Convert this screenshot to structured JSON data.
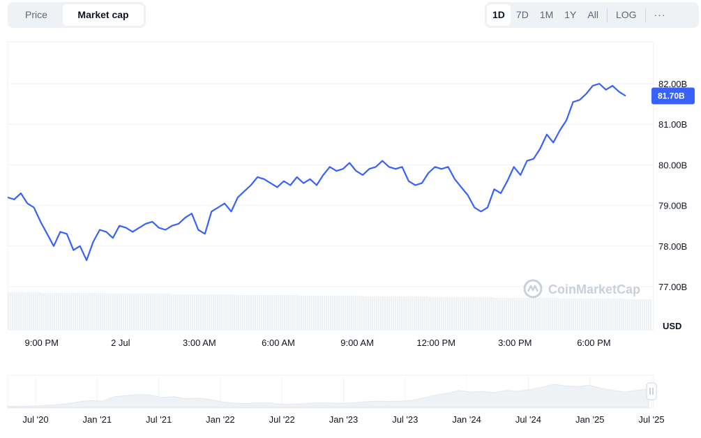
{
  "toggle": {
    "price_label": "Price",
    "market_cap_label": "Market cap",
    "selected": "Market cap"
  },
  "range_buttons": [
    "1D",
    "7D",
    "1M",
    "1Y",
    "All"
  ],
  "range_selected": "1D",
  "log_label": "LOG",
  "more_label": "···",
  "currency_label": "USD",
  "watermark": "CoinMarketCap",
  "colors": {
    "line": "#3861fb",
    "tag_bg": "#3861fb",
    "grid": "#eff2f5",
    "volume": "#eff2f5",
    "overview_fill": "#eff2f5"
  },
  "chart_data": {
    "type": "line",
    "main": {
      "x_tick_labels": [
        "9:00 PM",
        "2 Jul",
        "3:00 AM",
        "6:00 AM",
        "9:00 AM",
        "12:00 PM",
        "3:00 PM",
        "6:00 PM"
      ],
      "y_tick_labels": [
        "77.00B",
        "78.00B",
        "79.00B",
        "80.00B",
        "81.00B",
        "82.00B"
      ],
      "ylim": [
        77.0,
        82.0
      ],
      "y_unit": "USD",
      "current_value": 81.7,
      "current_label": "81.70B",
      "series": [
        {
          "x_hours": [
            0,
            0.25,
            0.5,
            0.75,
            1.0,
            1.25,
            1.5,
            1.75,
            2.0,
            2.25,
            2.5,
            2.75,
            3.0,
            3.25,
            3.5,
            3.75,
            4.0,
            4.25,
            4.5,
            4.75,
            5.0,
            5.25,
            5.5,
            5.75,
            6.0,
            6.25,
            6.5,
            6.75,
            7.0,
            7.25,
            7.5,
            7.75,
            8.0,
            8.25,
            8.5,
            8.75,
            9.0,
            9.25,
            9.5,
            9.75,
            10.0,
            10.25,
            10.5,
            10.75,
            11.0,
            11.25,
            11.5,
            11.75,
            12.0,
            12.25,
            12.5,
            12.75,
            13.0,
            13.25,
            13.5,
            13.75,
            14.0,
            14.25,
            14.5,
            14.75,
            15.0,
            15.25,
            15.5,
            15.75,
            16.0,
            16.25,
            16.5,
            16.75,
            17.0,
            17.25,
            17.5,
            17.75,
            18.0,
            18.25,
            18.5,
            18.75,
            19.0,
            19.25,
            19.5,
            19.75,
            20.0,
            20.25,
            20.5,
            20.75,
            21.0,
            21.25,
            21.5,
            21.75,
            22.0,
            22.25,
            22.5,
            22.75,
            23.0,
            23.25,
            23.5
          ],
          "values": [
            79.2,
            79.15,
            79.3,
            79.05,
            78.95,
            78.6,
            78.3,
            78.0,
            78.35,
            78.3,
            77.9,
            78.0,
            77.65,
            78.1,
            78.4,
            78.35,
            78.2,
            78.5,
            78.45,
            78.35,
            78.45,
            78.55,
            78.6,
            78.45,
            78.4,
            78.5,
            78.55,
            78.7,
            78.8,
            78.4,
            78.3,
            78.85,
            78.95,
            79.05,
            78.85,
            79.2,
            79.35,
            79.5,
            79.7,
            79.65,
            79.55,
            79.45,
            79.6,
            79.5,
            79.7,
            79.55,
            79.65,
            79.5,
            79.75,
            79.95,
            79.85,
            79.9,
            80.05,
            79.85,
            79.75,
            79.9,
            79.95,
            80.1,
            79.95,
            79.9,
            79.95,
            79.6,
            79.5,
            79.55,
            79.8,
            79.95,
            79.9,
            79.95,
            79.65,
            79.45,
            79.25,
            78.95,
            78.85,
            78.95,
            79.4,
            79.3,
            79.6,
            79.95,
            79.75,
            80.1,
            80.15,
            80.4,
            80.75,
            80.55,
            80.85,
            81.1,
            81.55,
            81.6,
            81.75,
            81.95,
            82.0,
            81.85,
            81.95,
            81.8,
            81.7
          ]
        }
      ]
    },
    "overview": {
      "x_tick_labels": [
        "Jul '20",
        "Jan '21",
        "Jul '21",
        "Jan '22",
        "Jul '22",
        "Jan '23",
        "Jul '23",
        "Jan '24",
        "Jul '24",
        "Jan '25",
        "Jul '25"
      ],
      "values": [
        0.03,
        0.03,
        0.04,
        0.06,
        0.08,
        0.12,
        0.18,
        0.22,
        0.2,
        0.35,
        0.38,
        0.42,
        0.4,
        0.32,
        0.35,
        0.28,
        0.3,
        0.26,
        0.18,
        0.14,
        0.12,
        0.15,
        0.14,
        0.1,
        0.1,
        0.12,
        0.15,
        0.14,
        0.13,
        0.14,
        0.18,
        0.2,
        0.19,
        0.2,
        0.22,
        0.3,
        0.4,
        0.45,
        0.55,
        0.5,
        0.52,
        0.48,
        0.55,
        0.52,
        0.58,
        0.65,
        0.75,
        0.7,
        0.68,
        0.72,
        0.62,
        0.55,
        0.5,
        0.55,
        0.6
      ]
    }
  }
}
